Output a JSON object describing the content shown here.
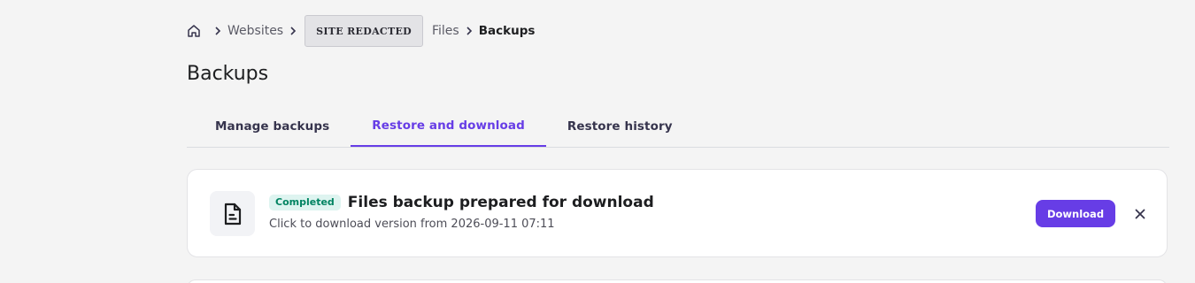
{
  "breadcrumb": {
    "home_icon": "home-icon",
    "items": [
      "Websites",
      "SITE REDACTED",
      "Files",
      "Backups"
    ]
  },
  "page": {
    "title": "Backups"
  },
  "tabs": [
    {
      "label": "Manage backups",
      "active": false
    },
    {
      "label": "Restore and download",
      "active": true
    },
    {
      "label": "Restore history",
      "active": false
    }
  ],
  "notification": {
    "icon": "file-document-icon",
    "status_badge": "Completed",
    "title": "Files backup prepared for download",
    "subtitle": "Click to download version from 2026-09-11 07:11",
    "download_label": "Download",
    "close_icon": "close-icon"
  },
  "colors": {
    "accent": "#673de6",
    "badge_bg": "#def4f0",
    "badge_text": "#008361",
    "background": "#f4f4f4"
  }
}
